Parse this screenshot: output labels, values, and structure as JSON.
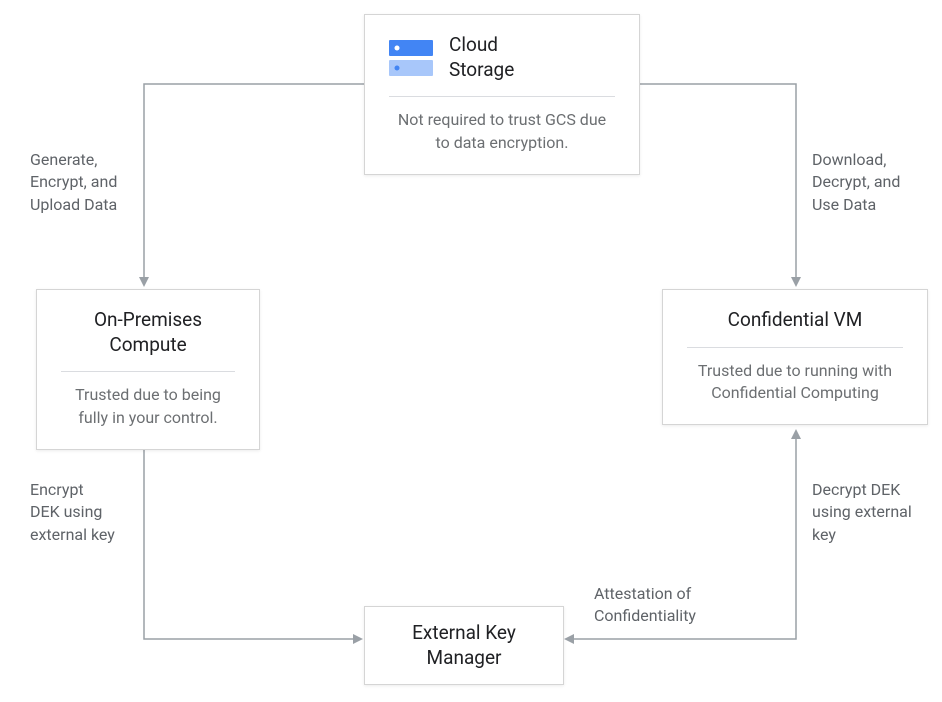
{
  "nodes": {
    "cloudStorage": {
      "title1": "Cloud",
      "title2": "Storage",
      "sub": "Not required to trust GCS due to data encryption."
    },
    "onPrem": {
      "title1": "On-Premises",
      "title2": "Compute",
      "sub": "Trusted due to being fully in your control."
    },
    "confVM": {
      "title": "Confidential VM",
      "sub": "Trusted due to running with Confidential Computing"
    },
    "ekm": {
      "title1": "External Key",
      "title2": "Manager"
    }
  },
  "edges": {
    "generateUpload": "Generate,\nEncrypt, and\nUpload Data",
    "downloadUse": "Download,\nDecrypt, and\nUse Data",
    "encryptDEK": "Encrypt\nDEK using\nexternal key",
    "decryptDEK": "Decrypt DEK\nusing external\nkey",
    "attestation": "Attestation of\nConfidentiality"
  }
}
